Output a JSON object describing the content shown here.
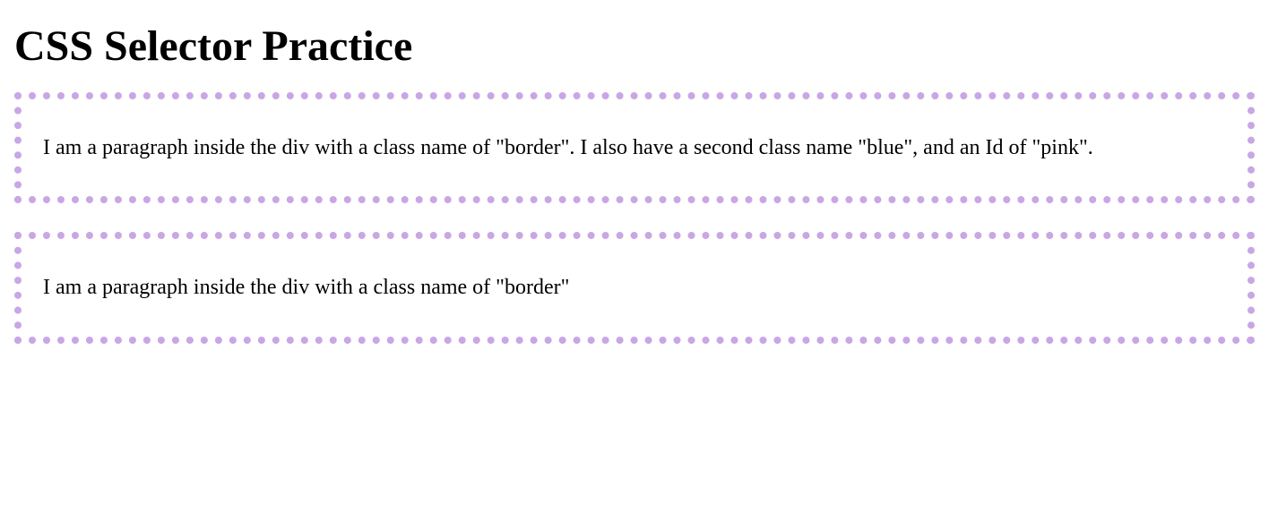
{
  "heading": "CSS Selector Practice",
  "boxes": [
    {
      "text": "I am a paragraph inside the div with a class name of \"border\". I also have a second class name \"blue\", and an Id of \"pink\"."
    },
    {
      "text": "I am a paragraph inside the div with a class name of \"border\""
    }
  ],
  "colors": {
    "border_dot": "#c9a6e4"
  }
}
